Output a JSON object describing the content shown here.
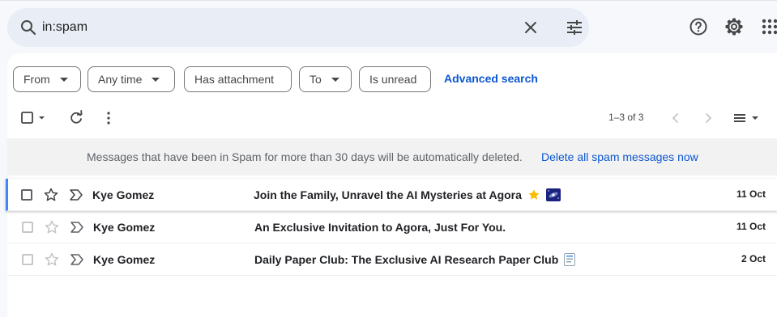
{
  "search": {
    "value": "in:spam",
    "search_icon": "search-icon",
    "clear_icon": "close-icon",
    "options_icon": "tune-icon"
  },
  "header": {
    "help_icon": "help-icon",
    "settings_icon": "gear-icon",
    "apps_icon": "apps-grid-icon"
  },
  "filters": {
    "chips": [
      {
        "label": "From",
        "has_dropdown": true
      },
      {
        "label": "Any time",
        "has_dropdown": true
      },
      {
        "label": "Has attachment",
        "has_dropdown": false
      },
      {
        "label": "To",
        "has_dropdown": true
      },
      {
        "label": "Is unread",
        "has_dropdown": false
      }
    ],
    "advanced_search": "Advanced search"
  },
  "toolbar": {
    "select_icon": "checkbox-icon",
    "refresh_icon": "refresh-icon",
    "more_icon": "more-vert-icon",
    "count": "1–3 of 3",
    "prev_icon": "chevron-left-icon",
    "next_icon": "chevron-right-icon",
    "density_icon": "density-icon"
  },
  "banner": {
    "message": "Messages that have been in Spam for more than 30 days will be automatically deleted.",
    "action": "Delete all spam messages now"
  },
  "emails": [
    {
      "sender": "Kye Gomez",
      "subject": "Join the Family, Unravel the AI Mysteries at Agora",
      "emojis": [
        "star-emoji",
        "galaxy-emoji"
      ],
      "date": "11 Oct",
      "selected": true
    },
    {
      "sender": "Kye Gomez",
      "subject": "An Exclusive Invitation to Agora, Just For You.",
      "emojis": [],
      "date": "11 Oct",
      "selected": false
    },
    {
      "sender": "Kye Gomez",
      "subject": "Daily Paper Club: The Exclusive AI Research Paper Club",
      "emojis": [
        "bookmark-tabs-emoji"
      ],
      "date": "2 Oct",
      "selected": false
    }
  ],
  "colors": {
    "accent": "#0b57d0",
    "search_bg": "#e9eef6",
    "page_bg": "#f6f8fc",
    "selected_bar": "#4285f4",
    "banner_bg": "#f2f2f2"
  }
}
